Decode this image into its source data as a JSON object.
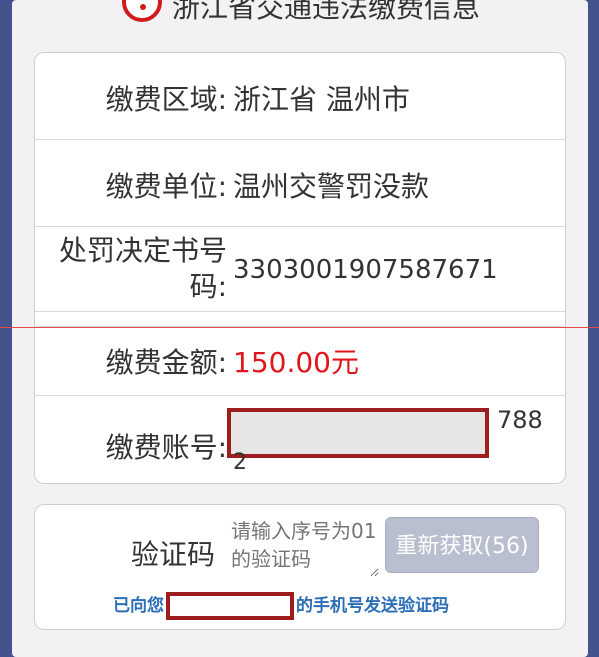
{
  "header": {
    "title": "浙江省交通违法缴费信息"
  },
  "payment": {
    "region_label": "缴费区域:",
    "region_value": "浙江省 温州市",
    "unit_label": "缴费单位:",
    "unit_value": "温州交警罚没款",
    "decision_label_line1": "处罚决定书号",
    "decision_label_line2": "码:",
    "decision_value": "3303001907587671",
    "amount_label": "缴费金额:",
    "amount_value": "150.00元",
    "account_label": "缴费账号:",
    "account_tail": "788",
    "account_wrap": "2"
  },
  "verify": {
    "label": "验证码",
    "placeholder": "请输入序号为01的验证码",
    "resend_label": "重新获取(56)",
    "sent_prefix": "已向您",
    "sent_suffix": "的手机号发送验证码"
  },
  "colors": {
    "amount": "#e0161c",
    "link": "#2c6fb7",
    "mask_border": "#a01d1d",
    "button_bg": "#b9bfcf"
  }
}
